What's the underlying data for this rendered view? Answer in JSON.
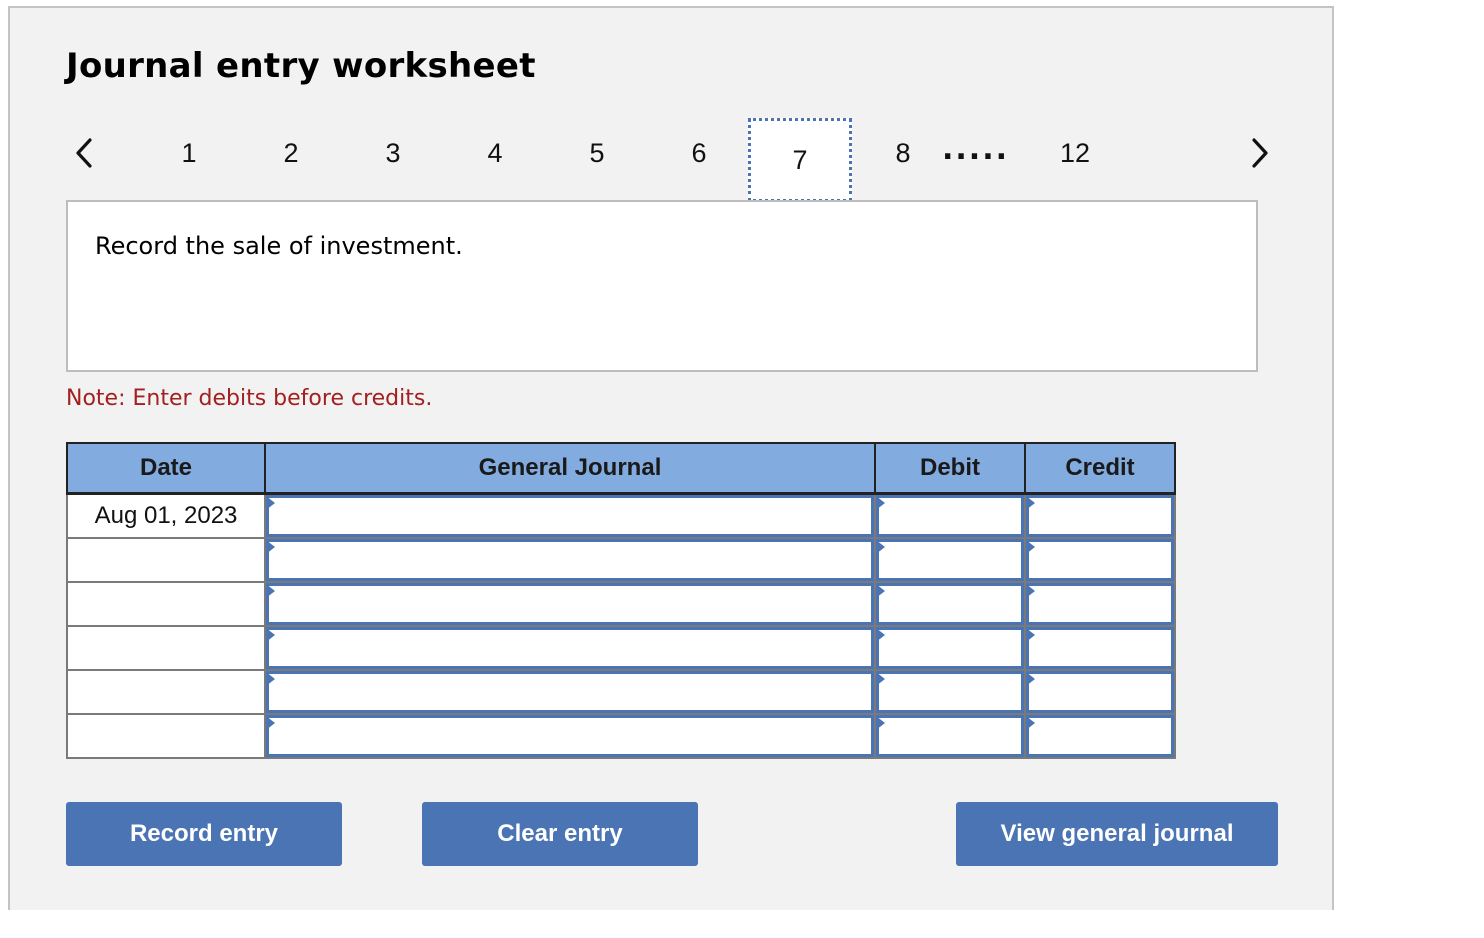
{
  "worksheet": {
    "title": "Journal entry worksheet",
    "nav": {
      "prev_icon": "chevron-left-icon",
      "next_icon": "chevron-right-icon",
      "pages": [
        "1",
        "2",
        "3",
        "4",
        "5",
        "6",
        "7",
        "8"
      ],
      "ellipsis": ".....",
      "last_page": "12",
      "active_page": "7"
    },
    "prompt": "Record the sale of investment.",
    "note": "Note: Enter debits before credits.",
    "colors": {
      "accent": "#4a74b4",
      "header_bg": "#82abe0",
      "note": "#a32020",
      "panel_bg": "#f2f2f2"
    }
  },
  "journal": {
    "headers": [
      "Date",
      "General Journal",
      "Debit",
      "Credit"
    ],
    "rows": [
      {
        "date": "Aug 01, 2023",
        "account": "",
        "debit": "",
        "credit": ""
      },
      {
        "date": "",
        "account": "",
        "debit": "",
        "credit": ""
      },
      {
        "date": "",
        "account": "",
        "debit": "",
        "credit": ""
      },
      {
        "date": "",
        "account": "",
        "debit": "",
        "credit": ""
      },
      {
        "date": "",
        "account": "",
        "debit": "",
        "credit": ""
      },
      {
        "date": "",
        "account": "",
        "debit": "",
        "credit": ""
      }
    ]
  },
  "buttons": {
    "record": "Record entry",
    "clear": "Clear entry",
    "view": "View general journal"
  }
}
